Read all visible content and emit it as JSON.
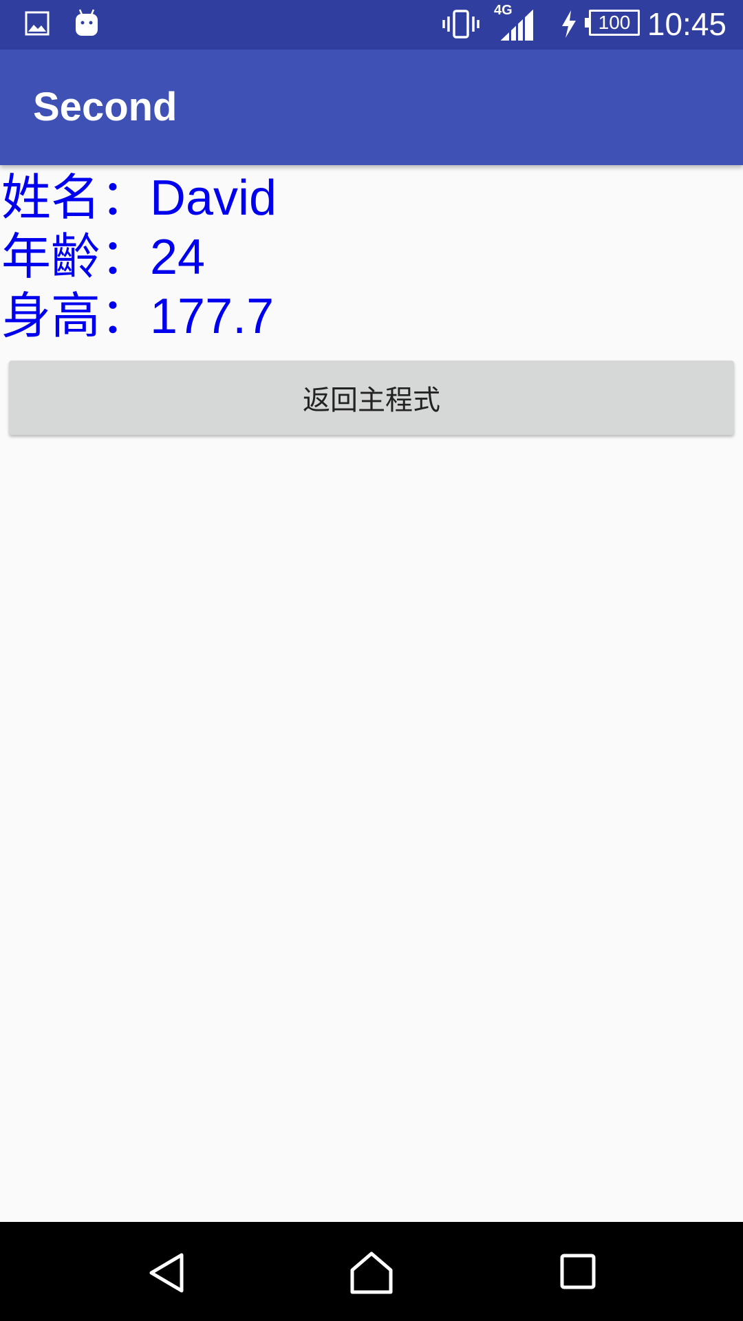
{
  "status_bar": {
    "time": "10:45",
    "network": "4G",
    "battery_level": "100",
    "icons": [
      "image-icon",
      "android-icon",
      "vibrate-icon",
      "signal-icon",
      "charging-icon",
      "battery-icon"
    ]
  },
  "app_bar": {
    "title": "Second"
  },
  "info": {
    "name_label": "姓名：",
    "name_value": "David",
    "age_label": "年齡：",
    "age_value": "24",
    "height_label": "身高：",
    "height_value": "177.7"
  },
  "return_button": {
    "label": "返回主程式"
  },
  "colors": {
    "status_bar": "#303f9f",
    "app_bar": "#3f51b5",
    "info_text": "#0000ee",
    "button_bg": "#d6d7d7",
    "background": "#fafafa"
  },
  "nav_bar": {
    "buttons": [
      "back-icon",
      "home-icon",
      "recents-icon"
    ]
  }
}
